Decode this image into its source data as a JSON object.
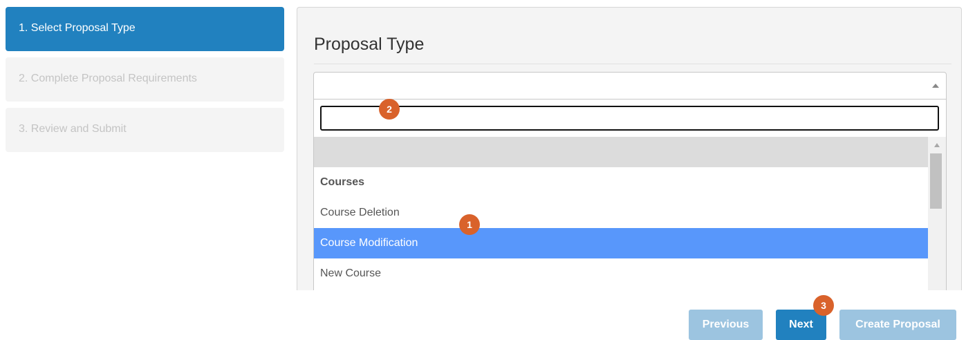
{
  "steps": [
    {
      "label": "1. Select Proposal Type",
      "state": "active"
    },
    {
      "label": "2. Complete Proposal Requirements",
      "state": "disabled"
    },
    {
      "label": "3. Review and Submit",
      "state": "disabled"
    }
  ],
  "panel": {
    "title": "Proposal Type",
    "select": {
      "value": "",
      "search_value": "",
      "options": [
        {
          "label": "",
          "kind": "empty"
        },
        {
          "label": "Courses",
          "kind": "group"
        },
        {
          "label": "Course Deletion",
          "kind": "option"
        },
        {
          "label": "Course Modification",
          "kind": "option",
          "selected": true
        },
        {
          "label": "New Course",
          "kind": "option"
        }
      ]
    }
  },
  "buttons": {
    "previous": "Previous",
    "next": "Next",
    "create": "Create Proposal"
  },
  "markers": {
    "one": "1",
    "two": "2",
    "three": "3"
  },
  "colors": {
    "primary": "#2181bf",
    "primary_disabled": "#9cc4e0",
    "highlight": "#5897fb",
    "marker": "#d9622b"
  }
}
